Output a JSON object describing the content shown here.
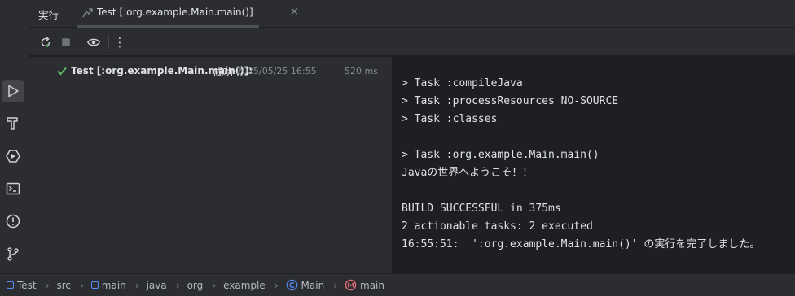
{
  "header": {
    "title": "実行",
    "tab_label": "Test [:org.example.Main.main()]",
    "tab_close": "×"
  },
  "toolbar": {
    "buttons": [
      "rerun-icon",
      "stop-icon",
      "eye-icon",
      "more-icon"
    ],
    "more_label": "⋮"
  },
  "leftbar": {
    "icons": [
      "run-icon",
      "build-hammer-icon",
      "services-icon",
      "terminal-icon",
      "problems-icon",
      "git-icon"
    ]
  },
  "test_tree": {
    "name": "Test [:org.example.Main.main()]:",
    "status": "成功",
    "datetime": "2025/05/25 16:55",
    "duration": "520 ms"
  },
  "console": {
    "lines": [
      "> Task :compileJava",
      "> Task :processResources NO-SOURCE",
      "> Task :classes",
      "",
      "> Task :org.example.Main.main()",
      "Javaの世界へようこそ！！",
      "",
      "BUILD SUCCESSFUL in 375ms",
      "2 actionable tasks: 2 executed",
      "16:55:51:  ':org.example.Main.main()' の実行を完了しました。"
    ]
  },
  "breadcrumbs": [
    "Test",
    "src",
    "main",
    "java",
    "org",
    "example",
    "Main",
    "main"
  ],
  "colors": {
    "success": "#5fb865",
    "accent": "#548af7",
    "background": "#1e1f22",
    "panel": "#2b2d30"
  }
}
